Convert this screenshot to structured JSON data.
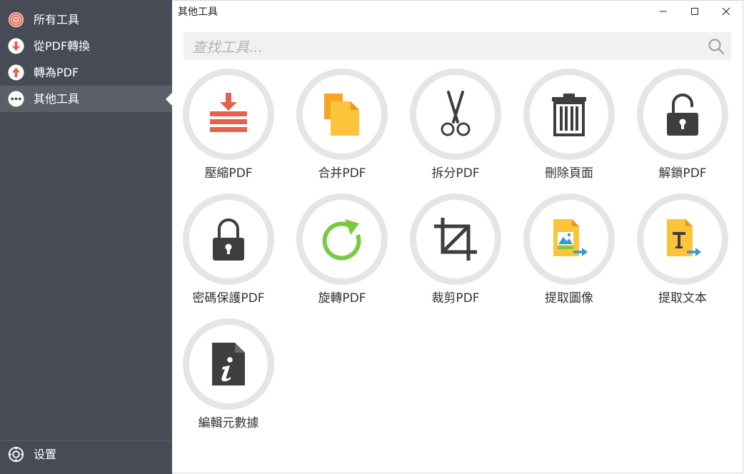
{
  "sidebar": {
    "items": [
      {
        "label": "所有工具",
        "icon": "all-tools-icon"
      },
      {
        "label": "從PDF轉換",
        "icon": "arrow-down-icon"
      },
      {
        "label": "轉為PDF",
        "icon": "arrow-up-icon"
      },
      {
        "label": "其他工具",
        "icon": "more-icon",
        "active": true
      }
    ],
    "settings_label": "设置",
    "colors": {
      "background": "#464b55",
      "active": "#5a5f68",
      "accent": "#e8604c"
    }
  },
  "window": {
    "title": "其他工具",
    "minimize_icon": "minimize-icon",
    "maximize_icon": "maximize-icon",
    "close_icon": "close-icon"
  },
  "search": {
    "placeholder": "查找工具...",
    "value": ""
  },
  "tools": [
    {
      "label": "壓縮PDF",
      "icon": "compress-icon"
    },
    {
      "label": "合并PDF",
      "icon": "merge-icon"
    },
    {
      "label": "拆分PDF",
      "icon": "scissors-icon"
    },
    {
      "label": "刪除頁面",
      "icon": "trash-icon"
    },
    {
      "label": "解鎖PDF",
      "icon": "unlock-icon"
    },
    {
      "label": "密碼保護PDF",
      "icon": "lock-icon"
    },
    {
      "label": "旋轉PDF",
      "icon": "rotate-icon"
    },
    {
      "label": "裁剪PDF",
      "icon": "crop-icon"
    },
    {
      "label": "提取圖像",
      "icon": "extract-image-icon"
    },
    {
      "label": "提取文本",
      "icon": "extract-text-icon"
    },
    {
      "label": "編輯元數據",
      "icon": "info-icon"
    }
  ]
}
